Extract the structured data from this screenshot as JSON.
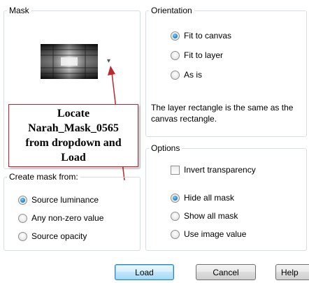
{
  "mask": {
    "title": "Mask",
    "dropdown_arrow": "▾"
  },
  "orientation": {
    "title": "Orientation",
    "options": [
      "Fit to canvas",
      "Fit to layer",
      "As is"
    ],
    "selected": 0,
    "description": "The layer rectangle is the same as the canvas rectangle."
  },
  "options": {
    "title": "Options",
    "invert_label": "Invert transparency",
    "invert_checked": false,
    "mask_options": [
      "Hide all mask",
      "Show all mask",
      "Use image value"
    ],
    "selected": 0
  },
  "create_mask": {
    "title": "Create mask from:",
    "options": [
      "Source luminance",
      "Any non-zero value",
      "Source opacity"
    ],
    "selected": 0
  },
  "annotation": {
    "lines": [
      "Locate",
      "Narah_Mask_0565",
      "from dropdown and",
      "Load"
    ],
    "color": "#c0262d"
  },
  "buttons": {
    "load": "Load",
    "cancel": "Cancel",
    "help": "Help"
  }
}
